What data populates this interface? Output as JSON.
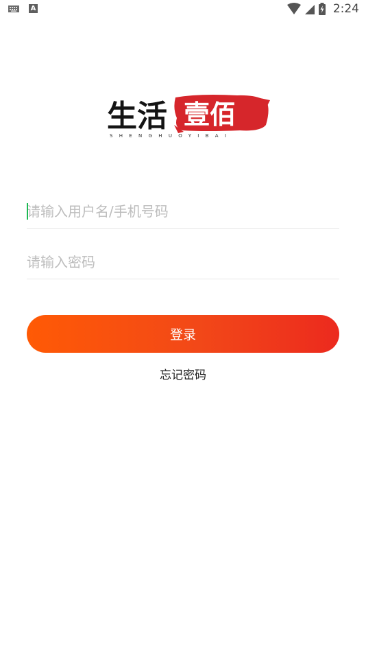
{
  "status_bar": {
    "time": "2:24",
    "icons": [
      "keyboard-icon",
      "a-badge-icon",
      "wifi-icon",
      "signal-icon",
      "battery-charging-icon"
    ],
    "badge_letter": "A"
  },
  "logo": {
    "text_left": "生活",
    "text_right": "壹佰",
    "caption": "SHENGHUOYIBAI",
    "brand_red": "#d6262b"
  },
  "form": {
    "username_placeholder": "请输入用户名/手机号码",
    "password_placeholder": "请输入密码",
    "login_label": "登录",
    "forgot_label": "忘记密码"
  },
  "colors": {
    "button_start": "#ff5a05",
    "button_end": "#ec2a1e",
    "caret": "#1db954",
    "placeholder": "#bdbdbd"
  }
}
